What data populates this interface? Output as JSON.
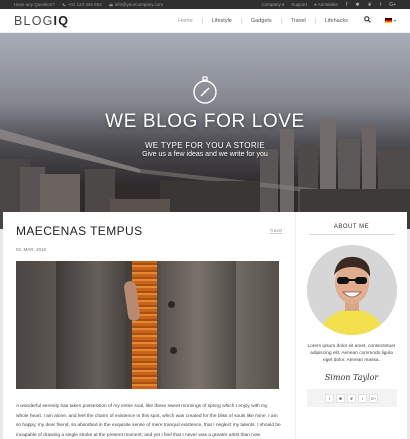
{
  "topbar": {
    "question": "Have any Question?",
    "phone": "+01 123 445 553",
    "email": "info@yourcompany.com",
    "company": "Company",
    "support": "Support",
    "account": "Anmelden",
    "social": [
      "f",
      "✱",
      "❦",
      "t",
      "G+"
    ]
  },
  "navbar": {
    "logo_main": "BLOG",
    "logo_bold": "IQ",
    "items": [
      {
        "label": "Home"
      },
      {
        "label": "Lifestyle"
      },
      {
        "label": "Gadgets"
      },
      {
        "label": "Travel"
      },
      {
        "label": "Lifehacks"
      }
    ],
    "search_icon": "search-icon",
    "language_flag": "german-flag"
  },
  "hero": {
    "icon": "compass-icon",
    "title": "WE BLOG FOR LOVE",
    "subtitle": "WE TYPE FOR YOU A STORIE",
    "description": "Give us a few ideas and we write for you"
  },
  "post": {
    "title": "MAECENAS TEMPUS",
    "category": "Travel",
    "date": "02. MAR, 2016",
    "text": "A wonderful serenity has taken possession of my entire soul, like these sweet mornings of spring which I enjoy with my whole heart. I am alone, and feel the charm of existence in this spot, which was created for the bliss of souls like mine. I am so happy, my dear friend, so absorbed in the exquisite sense of mere tranquil existence, that I neglect my talents. I should be incapable of drawing a single stroke at the present moment; and yet I feel that I never was a greater artist than now."
  },
  "sidebar": {
    "about_title": "ABOUT ME",
    "about_text": "Lorem ipsum dolor sit amet, consectetuer adipiscing elit. Aenean commodo ligula eget dolor. Aenean massa.",
    "signature": "Simon Taylor",
    "social": [
      "f",
      "✱",
      "❦",
      "t",
      "G+"
    ]
  },
  "colors": {
    "topbar_bg": "#2f2f2f",
    "nav_bg": "#ffffff",
    "hero_text": "#ffffff",
    "accent_yellow": "#f4e04d"
  }
}
